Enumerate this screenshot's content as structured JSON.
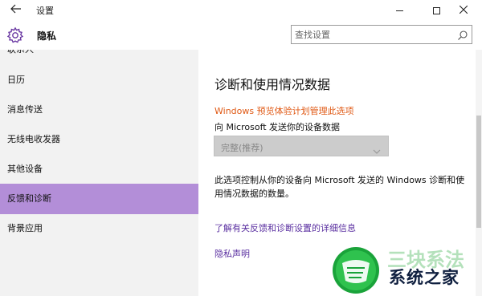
{
  "window": {
    "back_icon": "back-arrow-icon",
    "title": "设置",
    "controls": [
      "minimize-icon",
      "maximize-icon",
      "close-icon"
    ]
  },
  "header": {
    "icon": "gear-icon",
    "title": "隐私",
    "search_placeholder": "查找设置",
    "search_icon": "search-icon"
  },
  "sidebar": {
    "items": [
      {
        "label": "联系人",
        "selected": false
      },
      {
        "label": "日历",
        "selected": false
      },
      {
        "label": "消息传送",
        "selected": false
      },
      {
        "label": "无线电收发器",
        "selected": false
      },
      {
        "label": "其他设备",
        "selected": false
      },
      {
        "label": "反馈和诊断",
        "selected": true
      },
      {
        "label": "背景应用",
        "selected": false
      }
    ]
  },
  "main": {
    "heading": "诊断和使用情况数据",
    "managed_notice": "Windows 预览体验计划管理此选项",
    "send_label": "向 Microsoft 发送你的设备数据",
    "select_value": "完整(推荐)",
    "description": "此选项控制从你的设备向 Microsoft 发送的 Windows 诊断和使用情况数据的数量。",
    "link_feedback": "了解有关反馈和诊断设置的详细信息",
    "link_privacy": "隐私声明"
  },
  "watermark": {
    "text": "系统之家",
    "faint_text": "三块系法"
  },
  "colors": {
    "accent_selected": "#b38ed8",
    "notice": "#e05a16",
    "link": "#5a2fa0",
    "sidebar_bg": "#f2f2f2"
  }
}
